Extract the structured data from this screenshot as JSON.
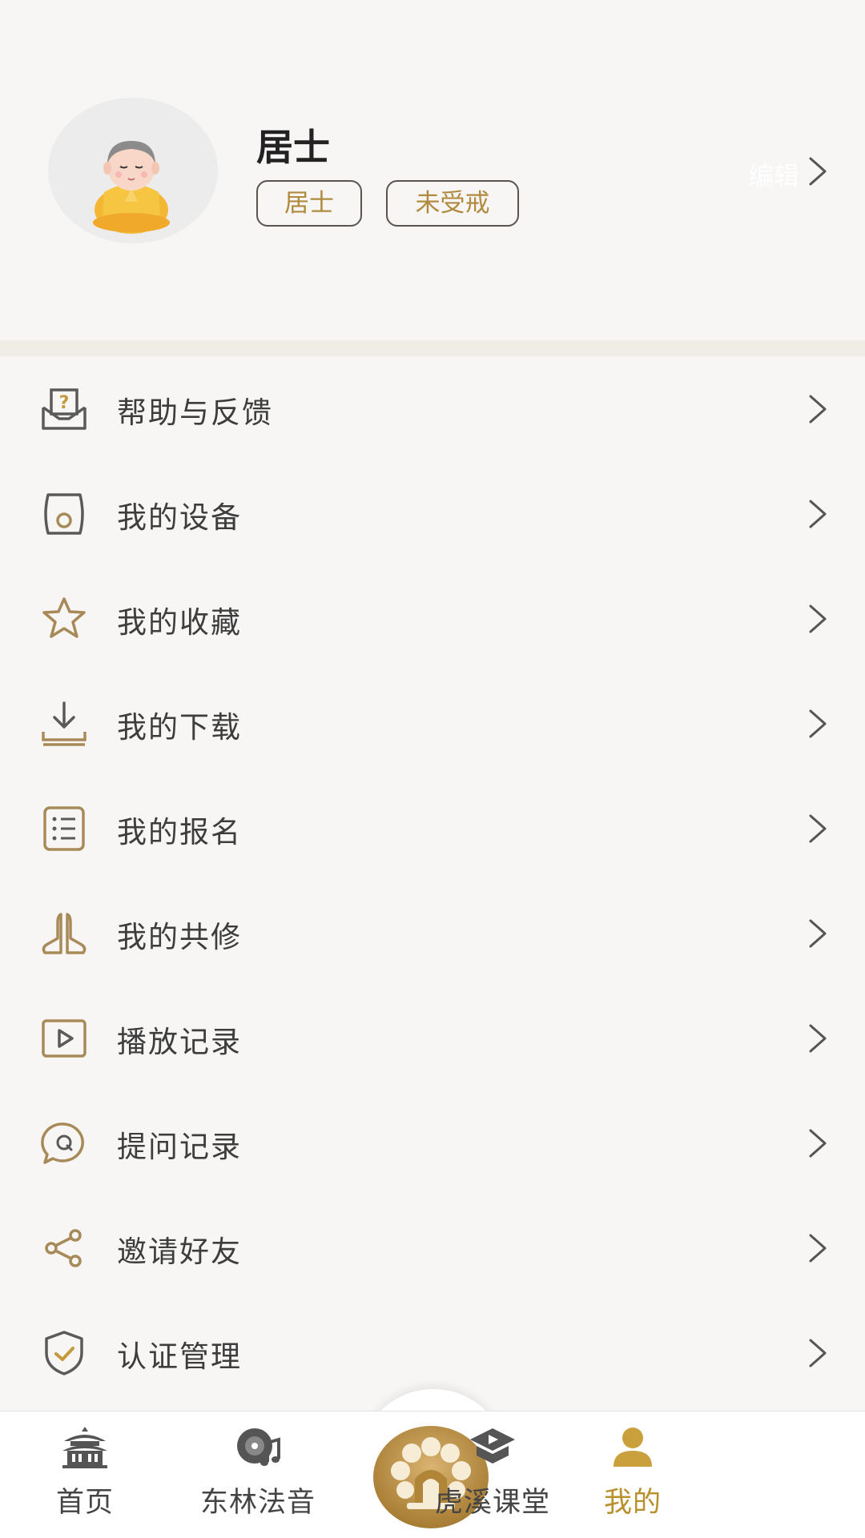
{
  "profile": {
    "name": "居士",
    "tags": [
      "居士",
      "未受戒"
    ],
    "edit_label": "编辑"
  },
  "colors": {
    "accent": "#b8902c",
    "icon": "#a88a58",
    "background": "#f7f6f5",
    "separator": "#efede6"
  },
  "menu": [
    {
      "label": "帮助与反馈",
      "icon": "help-mail-icon"
    },
    {
      "label": "我的设备",
      "icon": "device-icon"
    },
    {
      "label": "我的收藏",
      "icon": "star-icon"
    },
    {
      "label": "我的下载",
      "icon": "download-icon"
    },
    {
      "label": "我的报名",
      "icon": "list-icon"
    },
    {
      "label": "我的共修",
      "icon": "praying-hands-icon"
    },
    {
      "label": "播放记录",
      "icon": "play-icon"
    },
    {
      "label": "提问记录",
      "icon": "question-bubble-icon"
    },
    {
      "label": "邀请好友",
      "icon": "share-icon"
    },
    {
      "label": "认证管理",
      "icon": "shield-check-icon"
    }
  ],
  "tabs": [
    {
      "label": "首页",
      "icon": "temple-icon"
    },
    {
      "label": "东林法音",
      "icon": "music-disc-icon"
    },
    {
      "label": "",
      "icon": "lotus-logo-icon"
    },
    {
      "label": "虎溪课堂",
      "icon": "graduation-cap-icon"
    },
    {
      "label": "我的",
      "icon": "person-icon",
      "active": true
    }
  ]
}
